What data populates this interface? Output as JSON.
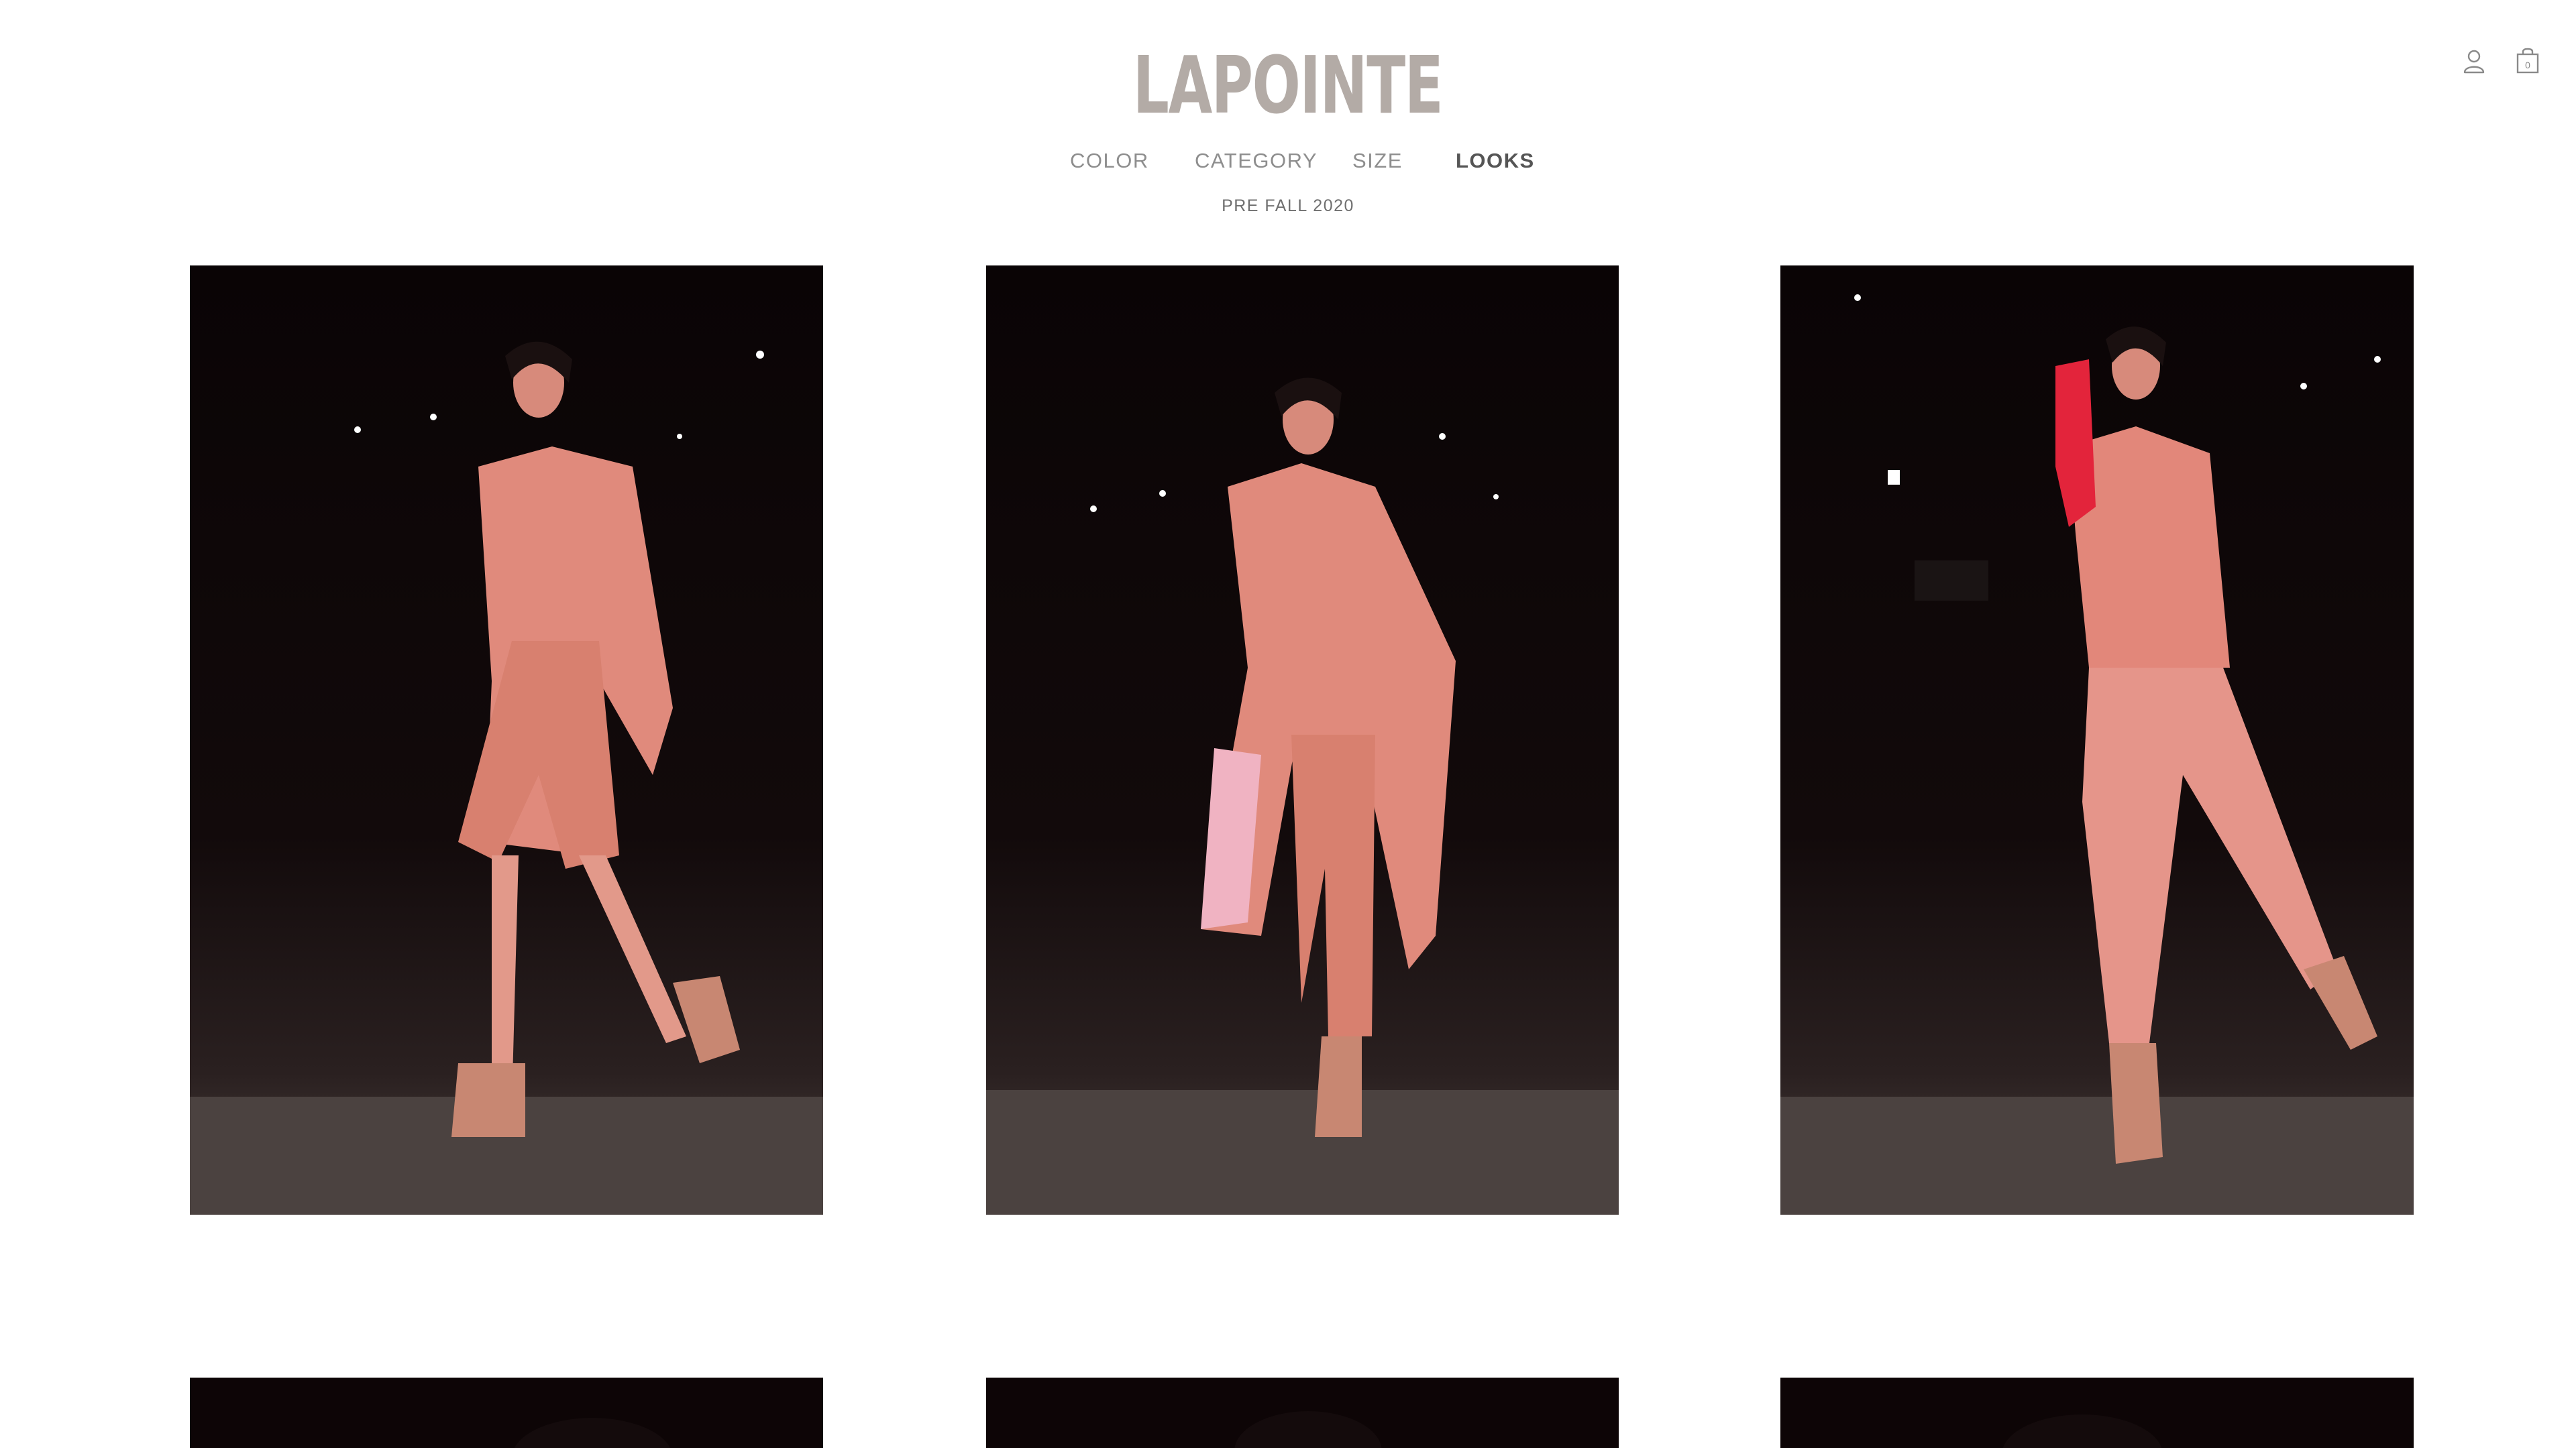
{
  "brand": {
    "name": "LAPOINTE"
  },
  "nav": {
    "items": [
      {
        "label": "COLOR"
      },
      {
        "label": "CATEGORY"
      },
      {
        "label": "SIZE"
      },
      {
        "label": "LOOKS",
        "active": true
      }
    ]
  },
  "subnav": {
    "label": "PRE FALL 2020"
  },
  "utility": {
    "account_icon": "user-icon",
    "bag_icon": "shopping-bag-icon",
    "bag_count": "0"
  },
  "colors": {
    "logo": "#b3aba6",
    "nav_text": "#8e8e8e",
    "nav_active": "#555555",
    "photo_bg": "#0c0607",
    "garment_salmon": "#e58d7f",
    "glove_red": "#e3243b"
  },
  "looks": [
    {
      "description_icon": "look-photo",
      "outfit": "salmon blazer, bodysuit, shorts, ankle boots"
    },
    {
      "description_icon": "look-photo",
      "outfit": "salmon trench coat, bodysuit, trousers, ankle boots"
    },
    {
      "description_icon": "look-photo",
      "outfit": "salmon sweater, trousers, red gloves, ankle boots"
    },
    {
      "description_icon": "look-photo"
    },
    {
      "description_icon": "look-photo"
    },
    {
      "description_icon": "look-photo"
    }
  ]
}
